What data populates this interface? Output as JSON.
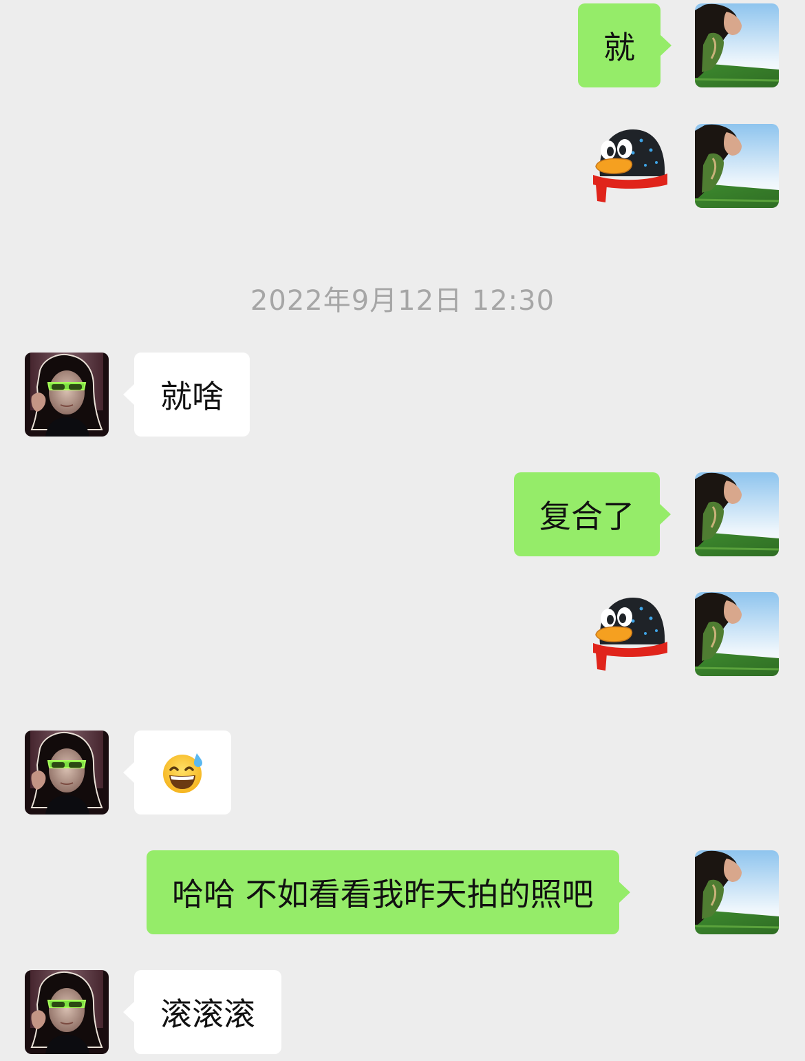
{
  "timestamp": "2022年9月12日 12:30",
  "avatars": {
    "self": "avatar-woman-leaning-grass-sky",
    "contact": "avatar-person-green-sunglasses"
  },
  "messages": [
    {
      "sender": "self",
      "type": "text",
      "text": "就"
    },
    {
      "sender": "self",
      "type": "sticker",
      "sticker": "qq-penguin-icon"
    },
    {
      "sender": "contact",
      "type": "text",
      "text": "就啥"
    },
    {
      "sender": "self",
      "type": "text",
      "text": "复合了"
    },
    {
      "sender": "self",
      "type": "sticker",
      "sticker": "qq-penguin-icon"
    },
    {
      "sender": "contact",
      "type": "emoji",
      "emoji": "grinning-sweat-emoji"
    },
    {
      "sender": "self",
      "type": "text",
      "text": "哈哈 不如看看我昨天拍的照吧"
    },
    {
      "sender": "contact",
      "type": "text",
      "text": "滚滚滚"
    }
  ],
  "colors": {
    "background": "#ededed",
    "outgoing_bubble": "#95ec69",
    "incoming_bubble": "#ffffff",
    "timestamp_text": "#a6a6a6"
  }
}
